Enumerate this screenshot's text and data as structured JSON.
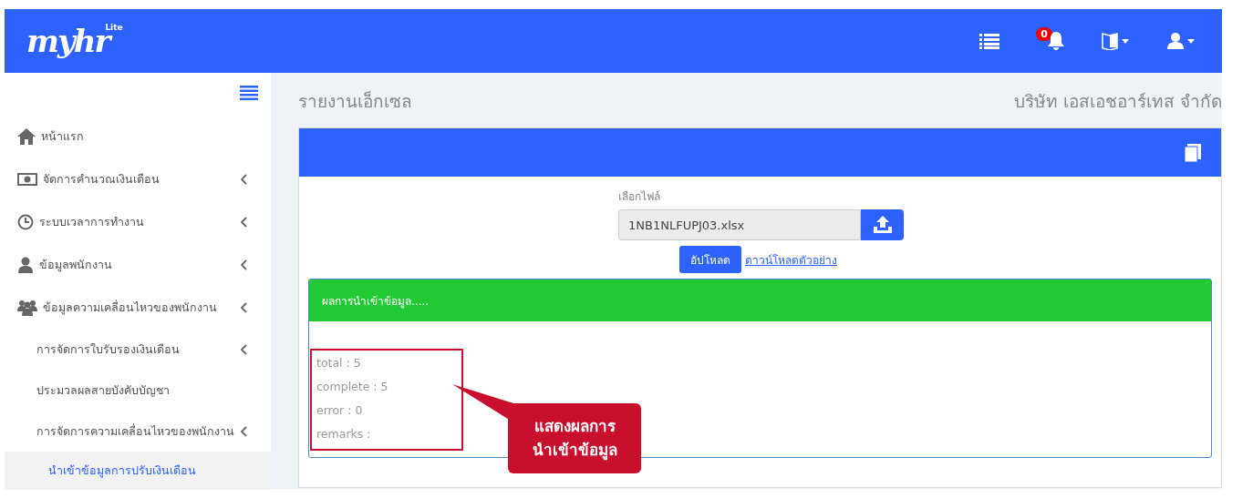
{
  "logo": {
    "text": "myhr",
    "badge": "Lite"
  },
  "header": {
    "notification_count": "0"
  },
  "sidebar": {
    "items": [
      {
        "label": "หน้าแรก",
        "kind": "home",
        "submenu": false,
        "selected": false
      },
      {
        "label": "จัดการคำนวณเงินเดือน",
        "kind": "money",
        "submenu": true,
        "selected": false
      },
      {
        "label": "ระบบเวลาการทำงาน",
        "kind": "clock",
        "submenu": true,
        "selected": false
      },
      {
        "label": "ข้อมูลพนักงาน",
        "kind": "user",
        "submenu": true,
        "selected": false
      },
      {
        "label": "ข้อมูลความเคลื่อนไหวของพนักงาน",
        "kind": "users",
        "submenu": true,
        "selected": false,
        "children": [
          {
            "label": "การจัดการใบรับรองเงินเดือน",
            "submenu": true,
            "selected": false
          },
          {
            "label": "ประมวลผลสายบังคับบัญชา",
            "submenu": false,
            "selected": false
          },
          {
            "label": "การจัดการความเคลื่อนไหวของพนักงาน",
            "submenu": true,
            "selected": false,
            "children": [
              {
                "label": "นำเข้าข้อมูลการปรับเงินเดือน",
                "submenu": false,
                "selected": true
              }
            ]
          }
        ]
      }
    ]
  },
  "page": {
    "title": "รายงานเอ็กเซล",
    "company": "บริษัท เอสเอชอาร์เทส จำกัด"
  },
  "upload": {
    "label": "เลือกไฟล์",
    "value": "1NB1NLFUPJ03.xlsx",
    "button": "อัปโหลด",
    "link": "ดาวน์โหลดตัวอย่าง"
  },
  "result": {
    "title": "ผลการนำเข้าข้อมูล.....",
    "lines": [
      "total : 5",
      "complete : 5",
      "error : 0",
      "remarks :"
    ]
  },
  "callout": {
    "lines": [
      "แสดงผลการ",
      "นำเข้าข้อมูล"
    ]
  }
}
